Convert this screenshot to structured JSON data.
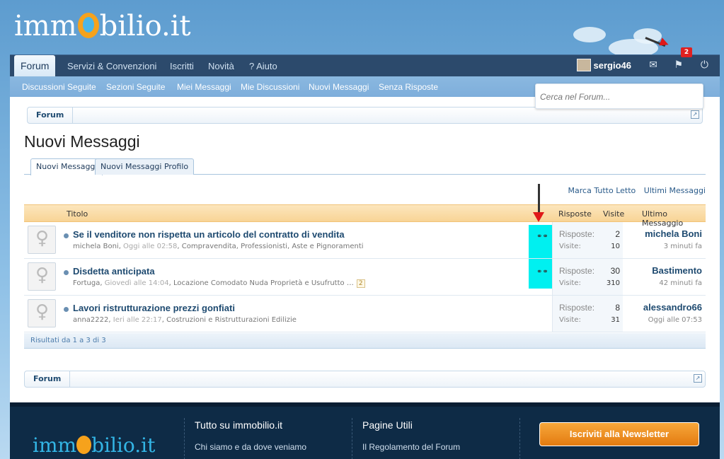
{
  "site": {
    "logo_text_a": "imm",
    "logo_text_b": "bilio.it"
  },
  "nav": {
    "tabs": [
      "Forum",
      "Servizi & Convenzioni",
      "Iscritti",
      "Novità",
      "? Aiuto"
    ],
    "username": "sergio46",
    "notifications_count": "2"
  },
  "subnav": {
    "items": [
      "Discussioni Seguite",
      "Sezioni Seguite",
      "Miei Messaggi",
      "Mie Discussioni",
      "Nuovi Messaggi",
      "Senza Risposte"
    ]
  },
  "search": {
    "placeholder": "Cerca nel Forum..."
  },
  "breadcrumb": {
    "label": "Forum"
  },
  "page": {
    "title": "Nuovi Messaggi",
    "tabs": [
      "Nuovi Messaggi",
      "Nuovi Messaggi Profilo"
    ],
    "mark_read": "Marca Tutto Letto",
    "latest": "Ultimi Messaggi"
  },
  "table": {
    "headers": {
      "title": "Titolo",
      "replies": "Risposte",
      "views": "Visite",
      "last": "Ultimo Messaggio"
    },
    "rows": [
      {
        "title": "Se il venditore non rispetta un articolo del contratto di vendita",
        "author": "michela Boni",
        "when": "Oggi alle 02:58",
        "sections": "Compravendita, Professionisti, Aste e Pignoramenti",
        "replies_label": "Risposte:",
        "replies": "2",
        "views_label": "Visite:",
        "views": "10",
        "last_user": "michela Boni",
        "last_time": "3 minuti fa",
        "pages": ""
      },
      {
        "title": "Disdetta anticipata",
        "author": "Fortuga",
        "when": "Giovedì alle 14:04",
        "sections": "Locazione Comodato Nuda Proprietà e Usufrutto",
        "replies_label": "Risposte:",
        "replies": "30",
        "views_label": "Visite:",
        "views": "310",
        "last_user": "Bastimento",
        "last_time": "42 minuti fa",
        "pages": "2"
      },
      {
        "title": "Lavori ristrutturazione prezzi gonfiati",
        "author": "anna2222",
        "when": "Ieri alle 22:17",
        "sections": "Costruzioni e Ristrutturazioni Edilizie",
        "replies_label": "Risposte:",
        "replies": "8",
        "views_label": "Visite:",
        "views": "31",
        "last_user": "alessandro66",
        "last_time": "Oggi alle 07:53",
        "pages": ""
      }
    ],
    "results": "Risultati da 1 a 3 di 3"
  },
  "footer": {
    "col1_title": "Tutto su immobilio.it",
    "col1_link": "Chi siamo e da dove veniamo",
    "col2_title": "Pagine Utili",
    "col2_link": "Il Regolamento del Forum",
    "newsletter": "Iscriviti alla Newsletter"
  },
  "colors": {
    "nav": "#2c4a6c",
    "subnav": "#7eaedb",
    "highlight": "#00f0f0",
    "header": "#f8d496"
  }
}
